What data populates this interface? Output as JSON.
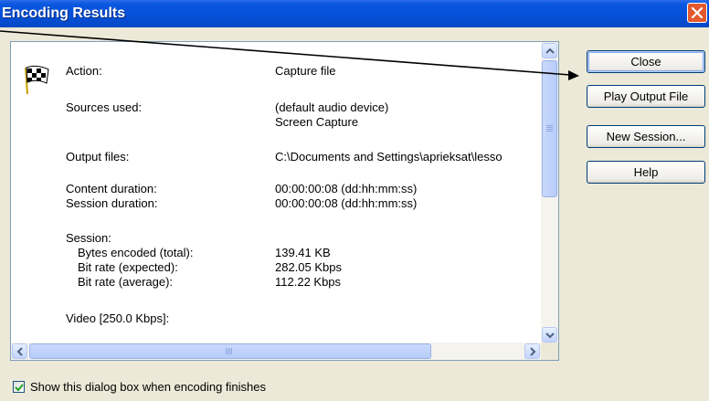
{
  "window": {
    "title": "Encoding Results",
    "close_icon": "close-icon"
  },
  "results": {
    "action": {
      "label": "Action:",
      "value": "Capture file"
    },
    "sources": {
      "label": "Sources used:",
      "values": [
        "(default audio device)",
        "Screen Capture"
      ]
    },
    "output_files": {
      "label": "Output files:",
      "value": "C:\\Documents and Settings\\aprieksat\\lesso"
    },
    "content_duration": {
      "label": "Content duration:",
      "value": "00:00:00:08  (dd:hh:mm:ss)"
    },
    "session_duration": {
      "label": "Session duration:",
      "value": "00:00:00:08  (dd:hh:mm:ss)"
    },
    "session": {
      "label": "Session:",
      "bytes_encoded": {
        "label": "Bytes encoded (total):",
        "value": "139.41 KB"
      },
      "bit_rate_expected": {
        "label": "Bit rate (expected):",
        "value": "282.05 Kbps"
      },
      "bit_rate_average": {
        "label": "Bit rate (average):",
        "value": "112.22 Kbps"
      }
    },
    "video": {
      "label": "Video [250.0 Kbps]:"
    }
  },
  "buttons": {
    "close": "Close",
    "play_output": "Play Output File",
    "new_session": "New Session...",
    "help": "Help"
  },
  "checkbox": {
    "label": "Show this dialog box when encoding finishes",
    "checked": true
  },
  "colors": {
    "titlebar": "#0550D8",
    "dialog_bg": "#ECE9D8",
    "close_button": "#E3592D"
  }
}
